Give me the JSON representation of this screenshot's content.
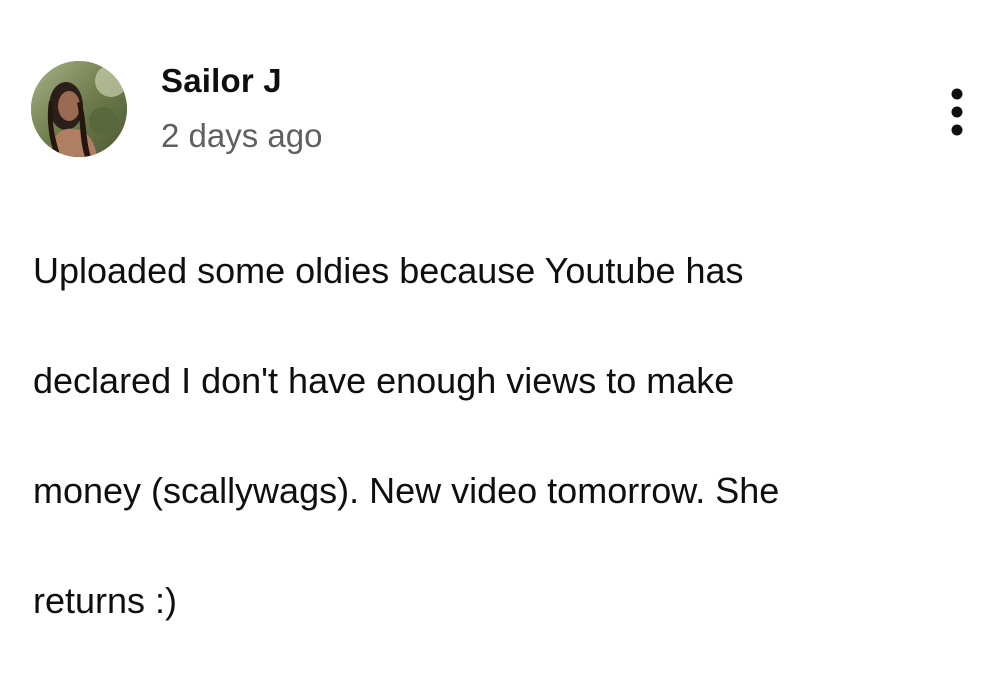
{
  "post": {
    "author": {
      "name": "Sailor J",
      "avatar_icon": "profile-photo-avatar"
    },
    "timestamp": "2 days ago",
    "menu_icon": "more-vertical-icon",
    "text_lines": [
      "Uploaded some oldies because Youtube  has",
      "declared I don't have enough views to make",
      "money (scallywags). New video tomorrow. She",
      "returns :)"
    ]
  }
}
